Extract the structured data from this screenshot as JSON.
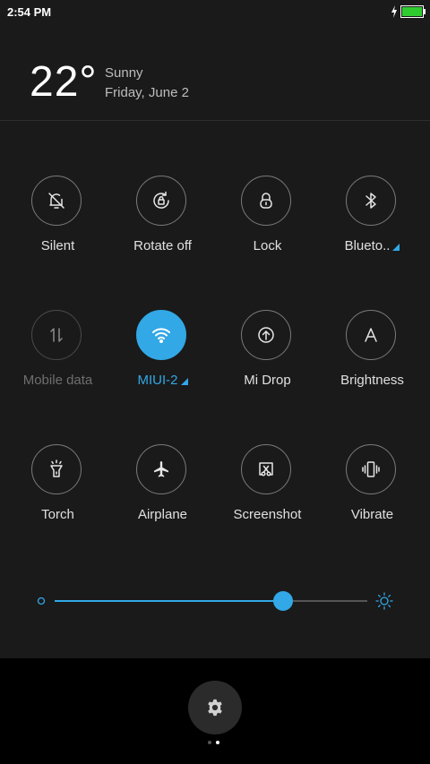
{
  "status_bar": {
    "time": "2:54 PM",
    "battery_color": "#2ecc2e"
  },
  "weather": {
    "temperature": "22°",
    "condition": "Sunny",
    "date": "Friday, June 2"
  },
  "tiles": [
    {
      "label": "Silent",
      "icon": "bell-off-icon",
      "state": "off"
    },
    {
      "label": "Rotate off",
      "icon": "rotate-lock-icon",
      "state": "off"
    },
    {
      "label": "Lock",
      "icon": "lock-icon",
      "state": "off"
    },
    {
      "label": "Blueto..",
      "icon": "bluetooth-icon",
      "state": "off",
      "has_more": true
    },
    {
      "label": "Mobile data",
      "icon": "mobile-data-icon",
      "state": "disabled"
    },
    {
      "label": "MIUI-2",
      "icon": "wifi-icon",
      "state": "on",
      "has_more": true
    },
    {
      "label": "Mi Drop",
      "icon": "mi-drop-icon",
      "state": "off"
    },
    {
      "label": "Brightness",
      "icon": "auto-brightness-icon",
      "state": "off"
    },
    {
      "label": "Torch",
      "icon": "flashlight-icon",
      "state": "off"
    },
    {
      "label": "Airplane",
      "icon": "airplane-icon",
      "state": "off"
    },
    {
      "label": "Screenshot",
      "icon": "screenshot-icon",
      "state": "off"
    },
    {
      "label": "Vibrate",
      "icon": "vibrate-icon",
      "state": "off"
    }
  ],
  "brightness": {
    "level": 0.73,
    "low_icon": "brightness-low-icon",
    "high_icon": "brightness-high-icon"
  },
  "settings": {
    "icon": "gear-icon"
  },
  "pager": {
    "page_count": 2,
    "current_page": 2
  },
  "colors": {
    "accent": "#32a8e6",
    "shade_background": "#1a1a1a",
    "dock_background": "#000000"
  }
}
